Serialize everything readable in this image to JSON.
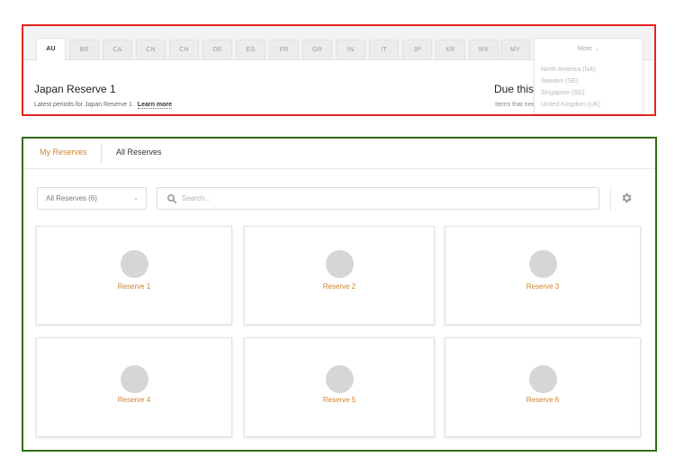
{
  "top_panel": {
    "country_tabs": [
      {
        "code": "AU",
        "active": true
      },
      {
        "code": "BR",
        "active": false
      },
      {
        "code": "CA",
        "active": false
      },
      {
        "code": "CN",
        "active": false
      },
      {
        "code": "CH",
        "active": false
      },
      {
        "code": "DE",
        "active": false
      },
      {
        "code": "ES",
        "active": false
      },
      {
        "code": "FR",
        "active": false
      },
      {
        "code": "GR",
        "active": false
      },
      {
        "code": "IN",
        "active": false
      },
      {
        "code": "IT",
        "active": false
      },
      {
        "code": "JP",
        "active": false
      },
      {
        "code": "KR",
        "active": false
      },
      {
        "code": "MX",
        "active": false
      },
      {
        "code": "MY",
        "active": false
      }
    ],
    "more": {
      "label": "More",
      "icon": "chevron-down-icon",
      "options": [
        "North America (NA)",
        "Sweden (SE)",
        "Singapore (SG)",
        "United Kingdom (UK)"
      ]
    },
    "reserve_title": "Japan Reserve 1",
    "reserve_subtitle": "Latest periods for Japan Reserve 1.",
    "learn_more": "Learn more",
    "due_title": "Due this",
    "due_subtitle": "Items that need"
  },
  "reserves_panel": {
    "tabs": [
      {
        "label": "My Reserves",
        "active": true
      },
      {
        "label": "All Reserves",
        "active": false
      }
    ],
    "filter": {
      "selected": "All Reserves (6)",
      "icon": "chevron-down-icon"
    },
    "search": {
      "placeholder": "Search...",
      "value": "",
      "icon": "search-icon"
    },
    "settings_icon": "gear-icon",
    "cards": [
      {
        "label": "Reserve 1"
      },
      {
        "label": "Reserve 2"
      },
      {
        "label": "Reserve 3"
      },
      {
        "label": "Reserve 4"
      },
      {
        "label": "Reserve 5"
      },
      {
        "label": "Reserve 6"
      }
    ]
  },
  "colors": {
    "highlight_red": "#e8231f",
    "highlight_green": "#2e6e0f",
    "accent_orange": "#d2832b"
  }
}
